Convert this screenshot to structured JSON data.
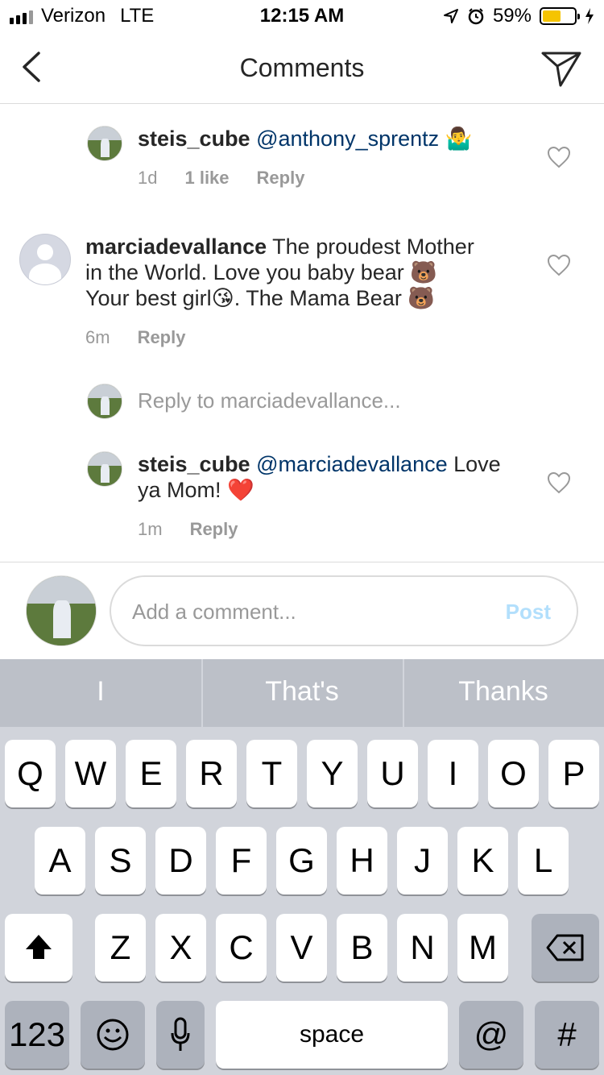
{
  "status_bar": {
    "carrier": "Verizon",
    "network": "LTE",
    "time": "12:15 AM",
    "battery_percent": "59%",
    "battery_level": 0.59
  },
  "nav": {
    "title": "Comments",
    "back_icon": "chevron-left-icon",
    "send_icon": "paper-plane-icon"
  },
  "comments": [
    {
      "user": "steis_cube",
      "mention": "@anthony_sprentz",
      "text": "",
      "emoji": "🤷‍♂️",
      "time": "1d",
      "likes": "1 like",
      "reply": "Reply"
    },
    {
      "user": "marciadevallance",
      "text_line1": "The proudest Mother",
      "text_line2": "in the World.  Love you baby bear 🐻",
      "text_line3": "Your best girl😘. The Mama Bear 🐻",
      "time": "6m",
      "reply": "Reply"
    },
    {
      "reply_prompt": "Reply to marciadevallance..."
    },
    {
      "user": "steis_cube",
      "mention": "@marciadevallance",
      "text_line1": "Love",
      "text_line2": "ya Mom! ❤️",
      "time": "1m",
      "reply": "Reply"
    }
  ],
  "composer": {
    "placeholder": "Add a comment...",
    "post_label": "Post"
  },
  "keyboard": {
    "suggestions": [
      "I",
      "That's",
      "Thanks"
    ],
    "row1": [
      "Q",
      "W",
      "E",
      "R",
      "T",
      "Y",
      "U",
      "I",
      "O",
      "P"
    ],
    "row2": [
      "A",
      "S",
      "D",
      "F",
      "G",
      "H",
      "J",
      "K",
      "L"
    ],
    "row3": [
      "Z",
      "X",
      "C",
      "V",
      "B",
      "N",
      "M"
    ],
    "numbers_label": "123",
    "space_label": "space",
    "at_label": "@",
    "hash_label": "#",
    "emoji_glyph": "☺",
    "colors": {
      "key": "#ffffff",
      "dark_key": "#adb2bc",
      "background": "#d1d4db"
    }
  },
  "colors": {
    "mention": "#003569",
    "secondary_text": "#999999",
    "post_disabled": "#b2dffc",
    "divider": "#dbdbdb"
  }
}
